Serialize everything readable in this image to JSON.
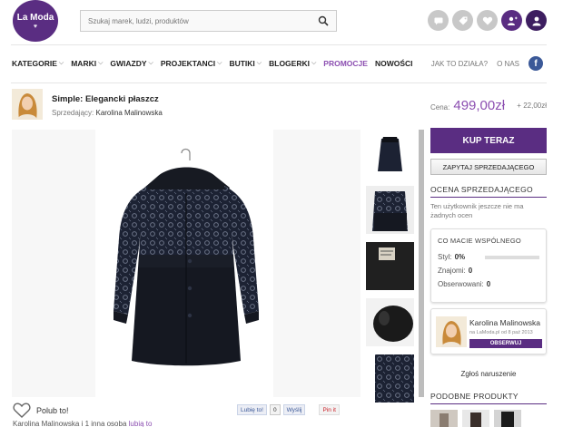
{
  "header": {
    "logo_text": "La Moda",
    "logo_sub": "♥",
    "search_placeholder": "Szukaj marek, ludzi, produktów",
    "icons": [
      "chat-icon",
      "tag-icon",
      "heart-icon",
      "add-user-icon",
      "profile-icon"
    ]
  },
  "nav": {
    "items": [
      {
        "label": "KATEGORIE",
        "caret": true
      },
      {
        "label": "MARKI",
        "caret": true
      },
      {
        "label": "GWIAZDY",
        "caret": true
      },
      {
        "label": "PROJEKTANCI",
        "caret": true
      },
      {
        "label": "BUTIKI",
        "caret": true
      },
      {
        "label": "BLOGERKI",
        "caret": true
      },
      {
        "label": "PROMOCJE",
        "caret": false
      },
      {
        "label": "NOWOŚCI",
        "caret": false
      }
    ],
    "how_it_works": "JAK TO DZIAŁA?",
    "about": "O NAS",
    "facebook": "f"
  },
  "product": {
    "title": "Simple: Elegancki płaszcz",
    "seller_label": "Sprzedający:",
    "seller_name": "Karolina Malinowska",
    "price_label": "Cena:",
    "price": "499,00zł",
    "shipping": "+ 22,00zł"
  },
  "sidebar": {
    "buy_label": "KUP TERAZ",
    "ask_label": "ZAPYTAJ SPRZEDAJĄCEGO",
    "rating_header": "OCENA SPRZEDAJĄCEGO",
    "rating_note": "Ten użytkownik jeszcze nie ma żadnych ocen",
    "common": {
      "header": "CO MACIE WSPÓLNEGO",
      "style_label": "Styl:",
      "style_value": "0%",
      "style_fraction": 0,
      "friends_label": "Znajomi:",
      "friends_value": "0",
      "observed_label": "Obserwowani:",
      "observed_value": "0"
    },
    "seller_box": {
      "name": "Karolina Malinowska",
      "since": "na LaModa.pl od 8 paź 2013",
      "observe_label": "OBSERWUJ"
    },
    "report": "Zgłoś naruszenie",
    "similar_header": "PODOBNE PRODUKTY"
  },
  "bottom": {
    "like_label": "Polub to!",
    "fb_like": "Lubię to!",
    "fb_count": "0",
    "send": "Wyślij",
    "pin": "Pin it",
    "likers_prefix": "Karolina Malinowska i 1 inna osoba",
    "likers_link": "lubią to"
  },
  "colors": {
    "brand": "#5a2d82",
    "accent": "#8c4fb1"
  }
}
